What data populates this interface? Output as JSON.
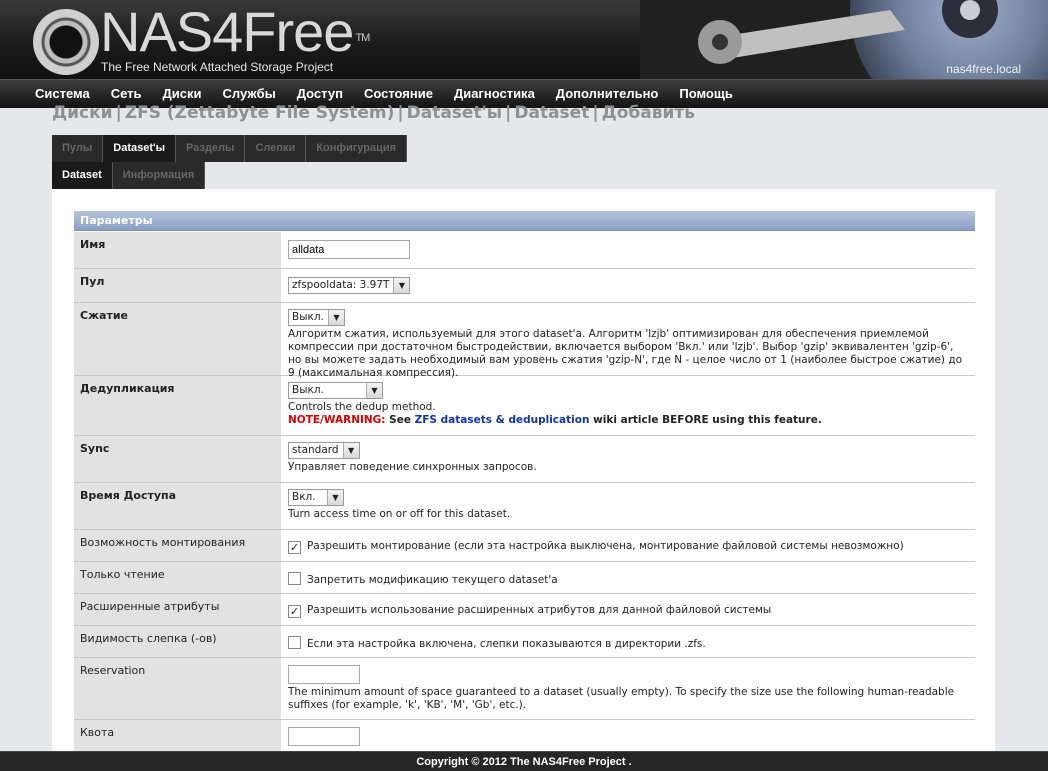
{
  "header": {
    "logo_main": "NAS4Free",
    "logo_tm": "TM",
    "tagline": "The Free Network Attached Storage Project",
    "hostname": "nas4free.local"
  },
  "nav": [
    "Система",
    "Сеть",
    "Диски",
    "Службы",
    "Доступ",
    "Состояние",
    "Диагностика",
    "Дополнительно",
    "Помощь"
  ],
  "breadcrumb": [
    "Диски",
    "ZFS (Zettabyte File System)",
    "Dataset'ы",
    "Dataset",
    "Добавить"
  ],
  "tabs_primary": [
    {
      "label": "Пулы",
      "active": false
    },
    {
      "label": "Dataset'ы",
      "active": true
    },
    {
      "label": "Разделы",
      "active": false
    },
    {
      "label": "Слепки",
      "active": false
    },
    {
      "label": "Конфигурация",
      "active": false
    }
  ],
  "tabs_secondary": [
    {
      "label": "Dataset",
      "active": true
    },
    {
      "label": "Информация",
      "active": false
    }
  ],
  "form": {
    "section_title": "Параметры",
    "name": {
      "label": "Имя",
      "value": "alldata"
    },
    "pool": {
      "label": "Пул",
      "value": "zfspooldata: 3.97T"
    },
    "compression": {
      "label": "Сжатие",
      "value": "Выкл.",
      "desc": "Алгоритм сжатия, используемый для этого dataset'a. Алгоритм 'lzjb' оптимизирован для обеспечения приемлемой компрессии при достаточном быстродействии, включается выбором 'Вкл.' или 'lzjb'. Выбор 'gzip' эквивалентен 'gzip-6', но вы можете задать необходимый вам уровень сжатия 'gzip-N', где N - целое число от 1 (наиболее быстрое сжатие) до 9 (максимальная компрессия)."
    },
    "dedup": {
      "label": "Дедупликация",
      "value": "Выкл.",
      "desc": "Controls the dedup method.",
      "warn": "NOTE/WARNING:",
      "warn_pre": " See ",
      "warn_link": "ZFS datasets & deduplication",
      "warn_post": " wiki article BEFORE using this feature."
    },
    "sync": {
      "label": "Sync",
      "value": "standard",
      "desc": "Управляет поведение синхронных запросов."
    },
    "atime": {
      "label": "Время Доступа",
      "value": "Вкл.",
      "desc": "Turn access time on or off for this dataset."
    },
    "canmount": {
      "label": "Возможность монтирования",
      "checked": true,
      "text": "Разрешить монтирование (если эта настройка выключена, монтирование файловой системы невозможно)"
    },
    "readonly": {
      "label": "Только чтение",
      "checked": false,
      "text": "Запретить модификацию текущего dataset'а"
    },
    "xattr": {
      "label": "Расширенные атрибуты",
      "checked": true,
      "text": "Разрешить использование расширенных атрибутов для данной файловой системы"
    },
    "snapdir": {
      "label": "Видимость слепка (-ов)",
      "checked": false,
      "text": "Если эта настройка включена, слепки показываются в директории .zfs."
    },
    "reservation": {
      "label": "Reservation",
      "value": "",
      "desc": "The minimum amount of space guaranteed to a dataset (usually empty). To specify the size use the following human-readable suffixes (for example, 'k', 'KB', 'M', 'Gb', etc.)."
    },
    "quota": {
      "label": "Квота",
      "value": ""
    }
  },
  "footer": "Copyright © 2012 The NAS4Free Project ."
}
